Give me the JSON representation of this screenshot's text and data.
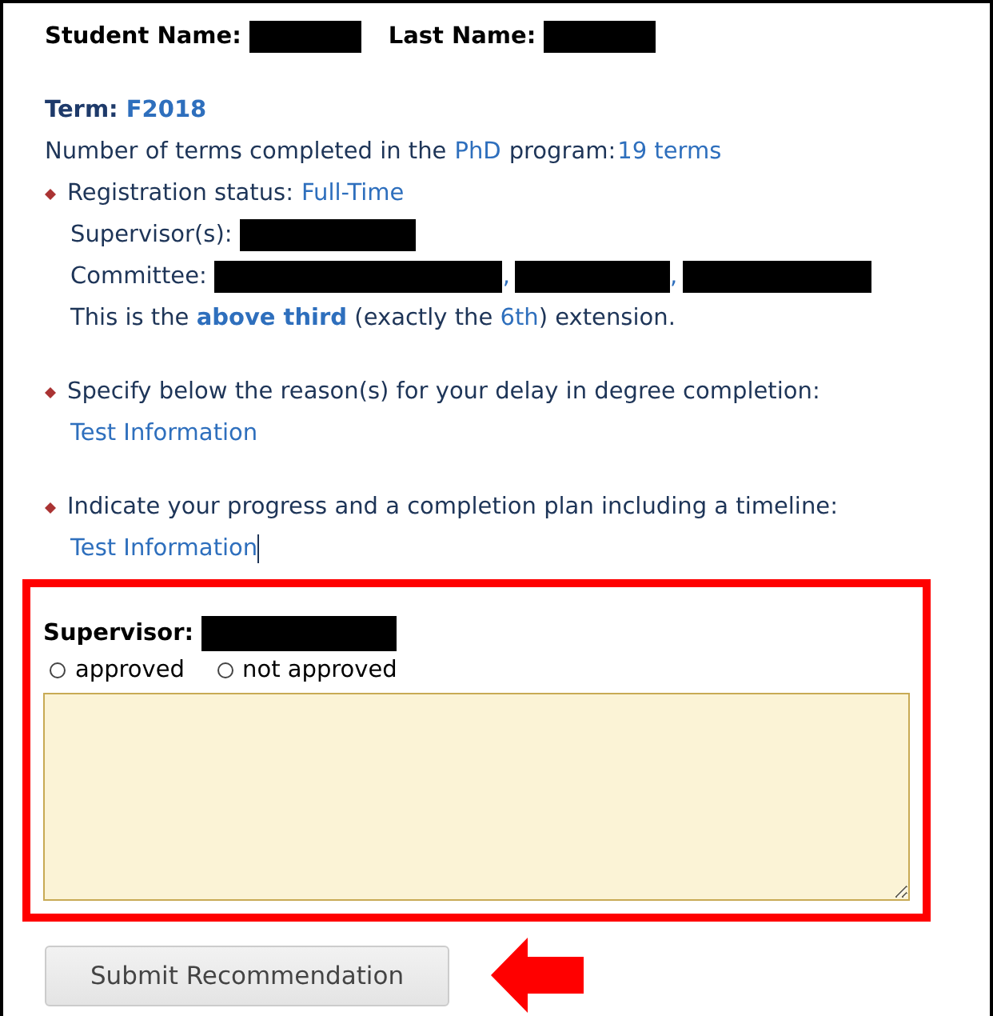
{
  "student": {
    "first_label": "Student Name:",
    "last_label": "Last Name:"
  },
  "term": {
    "label": "Term:",
    "value": "F2018"
  },
  "terms_completed": {
    "prefix": "Number of terms completed in the",
    "program": "PhD",
    "suffix": "program:",
    "value": "19 terms"
  },
  "registration": {
    "label": "Registration status:",
    "value": "Full-Time"
  },
  "supervisors_label": "Supervisor(s):",
  "committee": {
    "label": "Committee:",
    "separators": [
      ",",
      ","
    ]
  },
  "extension": {
    "before": "This is the",
    "level": "above third",
    "middle": "(exactly the",
    "ordinal": "6th",
    "after": ") extension."
  },
  "questions": [
    {
      "prompt": "Specify below the reason(s) for your delay in degree completion:",
      "answer": "Test Information",
      "cursor": false
    },
    {
      "prompt": "Indicate your progress and a completion plan including a timeline:",
      "answer": "Test Information",
      "cursor": true
    }
  ],
  "review": {
    "label": "Supervisor:",
    "options": [
      {
        "label": "approved",
        "selected": false
      },
      {
        "label": "not approved",
        "selected": false
      }
    ]
  },
  "submit": "Submit Recommendation"
}
